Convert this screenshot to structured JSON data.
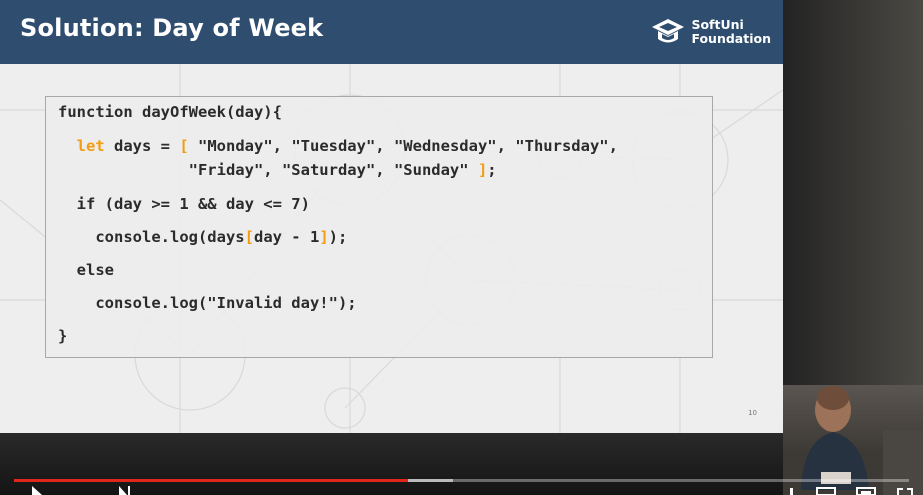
{
  "slide": {
    "title": "Solution: Day of Week",
    "brand": {
      "line1": "SoftUni",
      "line2": "Foundation",
      "logo_icon": "graduation-cap-icon"
    },
    "slide_number": "10",
    "code_lines": [
      [
        {
          "t": "function dayOfWeek(day){",
          "c": "plain"
        }
      ],
      [
        {
          "t": "  ",
          "c": "plain"
        },
        {
          "t": "let",
          "c": "kw"
        },
        {
          "t": " days = ",
          "c": "plain"
        },
        {
          "t": "[",
          "c": "br"
        },
        {
          "t": " \"Monday\", \"Tuesday\", \"Wednesday\", \"Thursday\",",
          "c": "plain"
        }
      ],
      [
        {
          "t": "              \"Friday\", \"Saturday\", \"Sunday\" ",
          "c": "plain"
        },
        {
          "t": "]",
          "c": "br"
        },
        {
          "t": ";",
          "c": "plain"
        }
      ],
      [
        {
          "t": "  if (day >= 1 && day <= 7)",
          "c": "plain"
        }
      ],
      [
        {
          "t": "    console.log(days",
          "c": "plain"
        },
        {
          "t": "[",
          "c": "br"
        },
        {
          "t": "day - 1",
          "c": "plain"
        },
        {
          "t": "]",
          "c": "br"
        },
        {
          "t": ");",
          "c": "plain"
        }
      ],
      [
        {
          "t": "  else",
          "c": "plain"
        }
      ],
      [
        {
          "t": "    console.log(\"Invalid day!\");",
          "c": "plain"
        }
      ],
      [
        {
          "t": "}",
          "c": "plain"
        }
      ]
    ]
  },
  "player": {
    "progress_played": 0.44,
    "progress_buffered": 0.49,
    "icons": [
      "play-icon",
      "next-icon",
      "volume-icon",
      "settings-icon",
      "miniplayer-icon",
      "fullscreen-icon"
    ]
  },
  "colors": {
    "header": "#2f4d6e",
    "keyword": "#f39c12",
    "progress": "#e1251b"
  }
}
